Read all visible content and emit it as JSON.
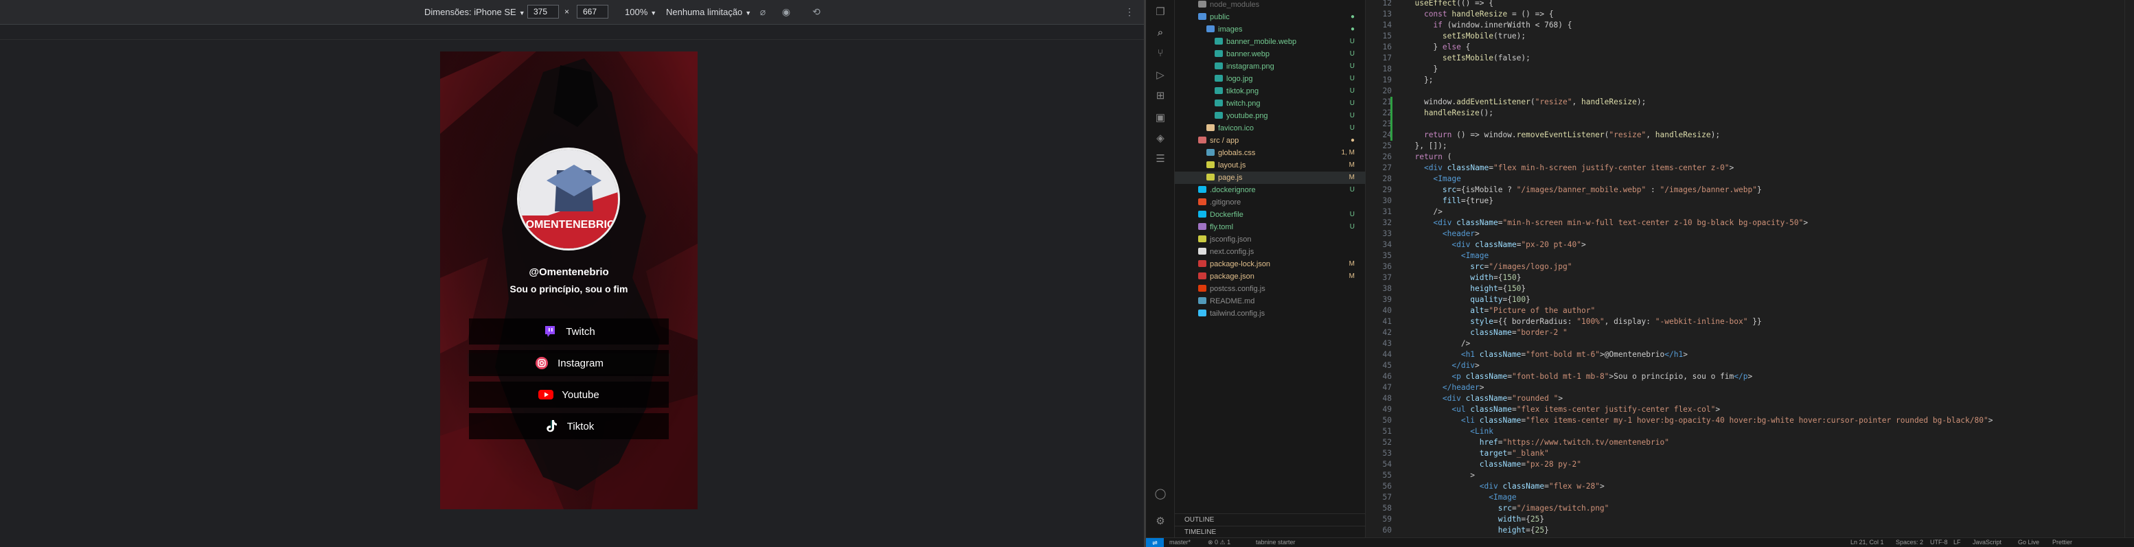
{
  "devtools": {
    "dimensions_label": "Dimensões: iPhone SE",
    "width_value": "375",
    "times": "×",
    "height_value": "667",
    "zoom": "100%",
    "throttle": "Nenhuma limitação"
  },
  "site": {
    "handle": "@Omentenebrio",
    "tagline": "Sou o princípio, sou o fim",
    "logo_text": "OMENTENEBRIO",
    "links": [
      {
        "label": "Twitch",
        "icon": "twitch-icon",
        "color": "#9146ff"
      },
      {
        "label": "Instagram",
        "icon": "instagram-icon",
        "color": "#e4405f"
      },
      {
        "label": "Youtube",
        "icon": "youtube-icon",
        "color": "#ff0000"
      },
      {
        "label": "Tiktok",
        "icon": "tiktok-icon",
        "color": "#ffffff"
      }
    ]
  },
  "explorer": {
    "items": [
      {
        "label": "node_modules",
        "indent": 0,
        "color": "#6d6d6d",
        "icon_color": "#8a8a8a",
        "status": ""
      },
      {
        "label": "public",
        "indent": 0,
        "color": "#73c991",
        "icon_color": "#4e8fd8",
        "status": "●"
      },
      {
        "label": "images",
        "indent": 1,
        "color": "#73c991",
        "icon_color": "#4e8fd8",
        "status": "●"
      },
      {
        "label": "banner_mobile.webp",
        "indent": 2,
        "color": "#73c991",
        "icon_color": "#2aa198",
        "status": "U"
      },
      {
        "label": "banner.webp",
        "indent": 2,
        "color": "#73c991",
        "icon_color": "#2aa198",
        "status": "U"
      },
      {
        "label": "instagram.png",
        "indent": 2,
        "color": "#73c991",
        "icon_color": "#2aa198",
        "status": "U"
      },
      {
        "label": "logo.jpg",
        "indent": 2,
        "color": "#73c991",
        "icon_color": "#2aa198",
        "status": "U"
      },
      {
        "label": "tiktok.png",
        "indent": 2,
        "color": "#73c991",
        "icon_color": "#2aa198",
        "status": "U"
      },
      {
        "label": "twitch.png",
        "indent": 2,
        "color": "#73c991",
        "icon_color": "#2aa198",
        "status": "U"
      },
      {
        "label": "youtube.png",
        "indent": 2,
        "color": "#73c991",
        "icon_color": "#2aa198",
        "status": "U"
      },
      {
        "label": "favicon.ico",
        "indent": 1,
        "color": "#73c991",
        "icon_color": "#e2c08d",
        "status": "U"
      },
      {
        "label": "src / app",
        "indent": 0,
        "color": "#e2c08d",
        "icon_color": "#d16969",
        "status": "●"
      },
      {
        "label": "globals.css",
        "indent": 1,
        "color": "#e2c08d",
        "icon_color": "#519aba",
        "status": "1, M"
      },
      {
        "label": "layout.js",
        "indent": 1,
        "color": "#e2c08d",
        "icon_color": "#cbcb41",
        "status": "M"
      },
      {
        "label": "page.js",
        "indent": 1,
        "color": "#e2c08d",
        "icon_color": "#cbcb41",
        "status": "M"
      },
      {
        "label": ".dockerignore",
        "indent": 0,
        "color": "#73c991",
        "icon_color": "#0db7ed",
        "status": "U"
      },
      {
        "label": ".gitignore",
        "indent": 0,
        "color": "#8c8c8c",
        "icon_color": "#e44d26",
        "status": ""
      },
      {
        "label": "Dockerfile",
        "indent": 0,
        "color": "#73c991",
        "icon_color": "#0db7ed",
        "status": "U"
      },
      {
        "label": "fly.toml",
        "indent": 0,
        "color": "#73c991",
        "icon_color": "#a074c4",
        "status": "U"
      },
      {
        "label": "jsconfig.json",
        "indent": 0,
        "color": "#8c8c8c",
        "icon_color": "#cbcb41",
        "status": ""
      },
      {
        "label": "next.config.js",
        "indent": 0,
        "color": "#8c8c8c",
        "icon_color": "#dddddd",
        "status": ""
      },
      {
        "label": "package-lock.json",
        "indent": 0,
        "color": "#e2c08d",
        "icon_color": "#cb3837",
        "status": "M"
      },
      {
        "label": "package.json",
        "indent": 0,
        "color": "#e2c08d",
        "icon_color": "#cb3837",
        "status": "M"
      },
      {
        "label": "postcss.config.js",
        "indent": 0,
        "color": "#8c8c8c",
        "icon_color": "#dd3a0a",
        "status": ""
      },
      {
        "label": "README.md",
        "indent": 0,
        "color": "#8c8c8c",
        "icon_color": "#519aba",
        "status": ""
      },
      {
        "label": "tailwind.config.js",
        "indent": 0,
        "color": "#8c8c8c",
        "icon_color": "#38bdf8",
        "status": ""
      }
    ],
    "outline_label": "OUTLINE",
    "timeline_label": "TIMELINE"
  },
  "code": {
    "lines": [
      {
        "n": "12",
        "t": "  useEffect(() => {"
      },
      {
        "n": "13",
        "t": "    const handleResize = () => {"
      },
      {
        "n": "14",
        "t": "      if (window.innerWidth < 768) {"
      },
      {
        "n": "15",
        "t": "        setIsMobile(true);"
      },
      {
        "n": "16",
        "t": "      } else {"
      },
      {
        "n": "17",
        "t": "        setIsMobile(false);"
      },
      {
        "n": "18",
        "t": "      }"
      },
      {
        "n": "19",
        "t": "    };"
      },
      {
        "n": "20",
        "t": ""
      },
      {
        "n": "21",
        "t": "    window.addEventListener(\"resize\", handleResize);"
      },
      {
        "n": "22",
        "t": "    handleResize();"
      },
      {
        "n": "23",
        "t": ""
      },
      {
        "n": "24",
        "t": "    return () => window.removeEventListener(\"resize\", handleResize);"
      },
      {
        "n": "25",
        "t": "  }, []);"
      },
      {
        "n": "26",
        "t": "  return ("
      },
      {
        "n": "27",
        "t": "    <div className=\"flex min-h-screen justify-center items-center z-0\">"
      },
      {
        "n": "28",
        "t": "      <Image"
      },
      {
        "n": "29",
        "t": "        src={isMobile ? \"/images/banner_mobile.webp\" : \"/images/banner.webp\"}"
      },
      {
        "n": "30",
        "t": "        fill={true}"
      },
      {
        "n": "31",
        "t": "      />"
      },
      {
        "n": "32",
        "t": "      <div className=\"min-h-screen min-w-full text-center z-10 bg-black bg-opacity-50\">"
      },
      {
        "n": "33",
        "t": "        <header>"
      },
      {
        "n": "34",
        "t": "          <div className=\"px-20 pt-40\">"
      },
      {
        "n": "35",
        "t": "            <Image"
      },
      {
        "n": "36",
        "t": "              src=\"/images/logo.jpg\""
      },
      {
        "n": "37",
        "t": "              width={150}"
      },
      {
        "n": "38",
        "t": "              height={150}"
      },
      {
        "n": "39",
        "t": "              quality={100}"
      },
      {
        "n": "40",
        "t": "              alt=\"Picture of the author\""
      },
      {
        "n": "41",
        "t": "              style={{ borderRadius: \"100%\", display: \"-webkit-inline-box\" }}"
      },
      {
        "n": "42",
        "t": "              className=\"border-2 \""
      },
      {
        "n": "43",
        "t": "            />"
      },
      {
        "n": "44",
        "t": "            <h1 className=\"font-bold mt-6\">@Omentenebrio</h1>"
      },
      {
        "n": "45",
        "t": "          </div>"
      },
      {
        "n": "46",
        "t": "          <p className=\"font-bold mt-1 mb-8\">Sou o princípio, sou o fim</p>"
      },
      {
        "n": "47",
        "t": "        </header>"
      },
      {
        "n": "48",
        "t": "        <div className=\"rounded \">"
      },
      {
        "n": "49",
        "t": "          <ul className=\"flex items-center justify-center flex-col\">"
      },
      {
        "n": "50",
        "t": "            <li className=\"flex items-center my-1 hover:bg-opacity-40 hover:bg-white hover:cursor-pointer rounded bg-black/80\">"
      },
      {
        "n": "51",
        "t": "              <Link"
      },
      {
        "n": "52",
        "t": "                href=\"https://www.twitch.tv/omentenebrio\""
      },
      {
        "n": "53",
        "t": "                target=\"_blank\""
      },
      {
        "n": "54",
        "t": "                className=\"px-28 py-2\""
      },
      {
        "n": "55",
        "t": "              >"
      },
      {
        "n": "56",
        "t": "                <div className=\"flex w-28\">"
      },
      {
        "n": "57",
        "t": "                  <Image"
      },
      {
        "n": "58",
        "t": "                    src=\"/images/twitch.png\""
      },
      {
        "n": "59",
        "t": "                    width={25}"
      },
      {
        "n": "60",
        "t": "                    height={25}"
      }
    ]
  },
  "status": {
    "branch": "master*",
    "errors": "⊗ 0 ⚠ 1",
    "tabnine": "tabnine starter",
    "position": "Ln 21, Col 1",
    "spaces": "Spaces: 2",
    "encoding": "UTF-8",
    "eol": "LF",
    "language": "JavaScript",
    "golive": "Go Live",
    "prettier": "Prettier"
  }
}
